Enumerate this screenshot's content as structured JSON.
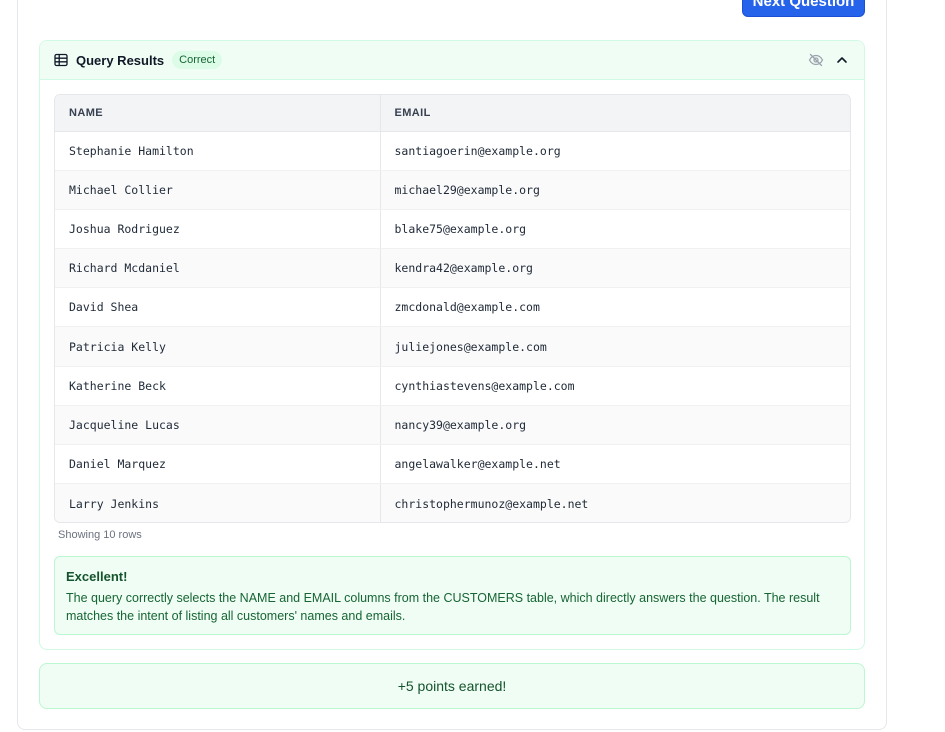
{
  "actions": {
    "next_question_label": "Next Question"
  },
  "results": {
    "title": "Query Results",
    "status_badge": "Correct",
    "columns": [
      "NAME",
      "EMAIL"
    ],
    "rows": [
      [
        "Stephanie Hamilton",
        "santiagoerin@example.org"
      ],
      [
        "Michael Collier",
        "michael29@example.org"
      ],
      [
        "Joshua Rodriguez",
        "blake75@example.org"
      ],
      [
        "Richard Mcdaniel",
        "kendra42@example.org"
      ],
      [
        "David Shea",
        "zmcdonald@example.com"
      ],
      [
        "Patricia Kelly",
        "juliejones@example.com"
      ],
      [
        "Katherine Beck",
        "cynthiastevens@example.com"
      ],
      [
        "Jacqueline Lucas",
        "nancy39@example.org"
      ],
      [
        "Daniel Marquez",
        "angelawalker@example.net"
      ],
      [
        "Larry Jenkins",
        "christophermunoz@example.net"
      ]
    ],
    "row_count_text": "Showing 10 rows"
  },
  "feedback": {
    "title": "Excellent!",
    "text": "The query correctly selects the NAME and EMAIL columns from the CUSTOMERS table, which directly answers the question. The result matches the intent of listing all customers' names and emails."
  },
  "points": {
    "text": "+5 points earned!"
  },
  "colors": {
    "primary": "#2563eb",
    "success_bg": "#f0fdf4",
    "success_border": "#bbf7d0",
    "success_text": "#166534"
  },
  "icons": {
    "table": "table-icon",
    "hide": "eye-off-icon",
    "collapse": "chevron-up-icon"
  }
}
